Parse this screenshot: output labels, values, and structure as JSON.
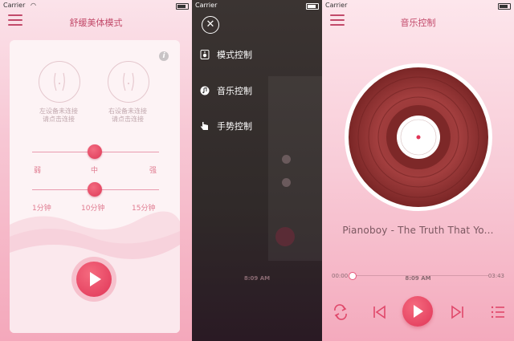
{
  "status": {
    "carrier": "Carrier",
    "time": "8:09 AM"
  },
  "screen1": {
    "title": "舒缓美体模式",
    "left_device": {
      "line1": "左设备未连接",
      "line2": "请点击连接"
    },
    "right_device": {
      "line1": "右设备未连接",
      "line2": "请点击连接"
    },
    "intensity": {
      "labels": [
        "弱",
        "中",
        "强"
      ],
      "value": "中"
    },
    "duration": {
      "labels": [
        "1分钟",
        "10分钟",
        "15分钟"
      ],
      "value": "10分钟"
    },
    "info_icon": "i"
  },
  "screen2": {
    "close_icon": "✕",
    "menu": [
      {
        "icon": "speaker-icon",
        "label": "模式控制"
      },
      {
        "icon": "music-icon",
        "label": "音乐控制"
      },
      {
        "icon": "hand-icon",
        "label": "手势控制"
      }
    ]
  },
  "screen3": {
    "title": "音乐控制",
    "song": "Pianoboy - The Truth That Yo...",
    "elapsed": "00:00",
    "duration": "03:43",
    "progress": 0.0
  },
  "colors": {
    "accent": "#e03557",
    "title": "#c24a6a",
    "pink_bg": "#f7c7d4"
  }
}
